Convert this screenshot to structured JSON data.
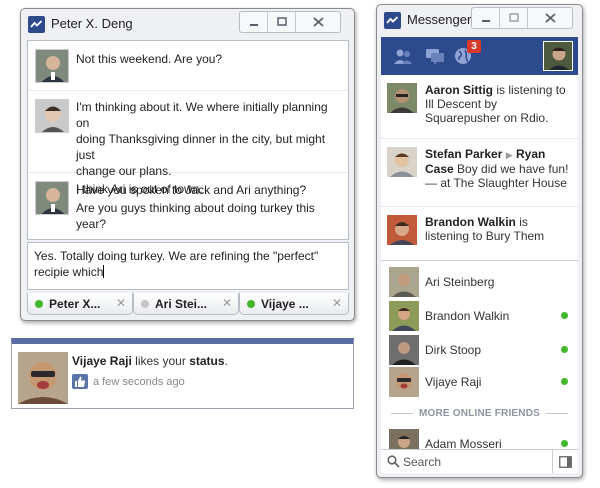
{
  "colors": {
    "brand": "#2c4a8c",
    "online": "#42b72a",
    "idle": "#c5c5c5",
    "badge": "#d73a2c"
  },
  "chat_window": {
    "title": "Peter X. Deng",
    "messages": [
      {
        "lines": [
          "Not this weekend. Are you?"
        ]
      },
      {
        "lines": [
          "I'm thinking about it. We where initially planning on",
          "doing Thanksgiving dinner in the city, but might just",
          "change our plans.",
          "Have you spoken to Jack and Ari anything?"
        ]
      },
      {
        "lines": [
          "I think Ari is out of town.",
          "Are you guys thinking about doing turkey this year?"
        ]
      }
    ],
    "compose_text": "Yes. Totally doing turkey. We are refining the \"perfect\" recipie which",
    "tabs": [
      {
        "name": "Peter X...",
        "status": "online"
      },
      {
        "name": "Ari Stei...",
        "status": "idle"
      },
      {
        "name": "Vijaye ...",
        "status": "online"
      }
    ]
  },
  "notification": {
    "actor": "Vijaye Raji",
    "verb": "likes your",
    "object": "status",
    "punct": ".",
    "time": "a few seconds ago"
  },
  "messenger": {
    "title": "Messenger",
    "notification_count": "3",
    "ticker": [
      {
        "name": "Aaron Sittig",
        "text": " is listening to Ill Descent by Squarepusher on Rdio."
      },
      {
        "name": "Stefan Parker",
        "arrow": "▶",
        "name2": "Ryan Case",
        "text": " Boy did we have fun! — at The Slaughter House"
      },
      {
        "name": "Brandon Walkin",
        "text": " is listening to Bury Them"
      }
    ],
    "friends": [
      {
        "name": "Ari Steinberg",
        "online": false
      },
      {
        "name": "Brandon Walkin",
        "online": true
      },
      {
        "name": "Dirk Stoop",
        "online": true
      },
      {
        "name": "Vijaye Raji",
        "online": true
      }
    ],
    "more_label": "MORE ONLINE FRIENDS",
    "more_friends": [
      {
        "name": "Adam Mosseri",
        "online": true
      }
    ],
    "search_label": "Search"
  }
}
